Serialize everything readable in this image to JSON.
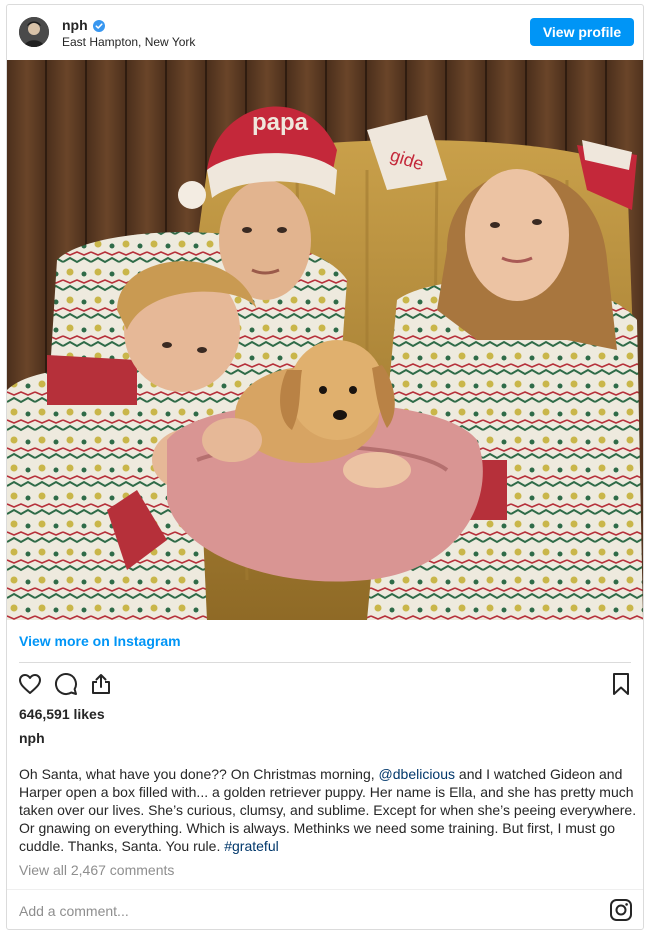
{
  "header": {
    "username": "nph",
    "location": "East Hampton, New York",
    "view_profile_label": "View profile"
  },
  "photo": {
    "hat_text": "papa",
    "stocking_text": "gide"
  },
  "view_more_label": "View more on Instagram",
  "likes": "646,591 likes",
  "owner": "nph",
  "caption": {
    "part1": "Oh Santa, what have you done?? On Christmas morning, ",
    "mention": "@dbelicious",
    "part2": " and I watched Gideon and Harper open a box filled with... a golden retriever puppy. Her name is Ella, and she has pretty much taken over our lives. She’s curious, clumsy, and sublime. Except for when she’s peeing everywhere. Or gnawing on everything. Which is always. Methinks we need some training. But first, I must go cuddle. Thanks, Santa. You rule. ",
    "hashtag": "#grateful"
  },
  "view_all_comments": "View all 2,467 comments",
  "comment_placeholder": "Add a comment...",
  "icons": {
    "verified": "verified-badge-icon",
    "like": "heart-icon",
    "comment": "comment-bubble-icon",
    "share": "share-icon",
    "save": "bookmark-icon",
    "brand": "instagram-icon"
  },
  "colors": {
    "accent": "#0095f6",
    "mention": "#00376b",
    "muted": "#8e8e8e"
  }
}
